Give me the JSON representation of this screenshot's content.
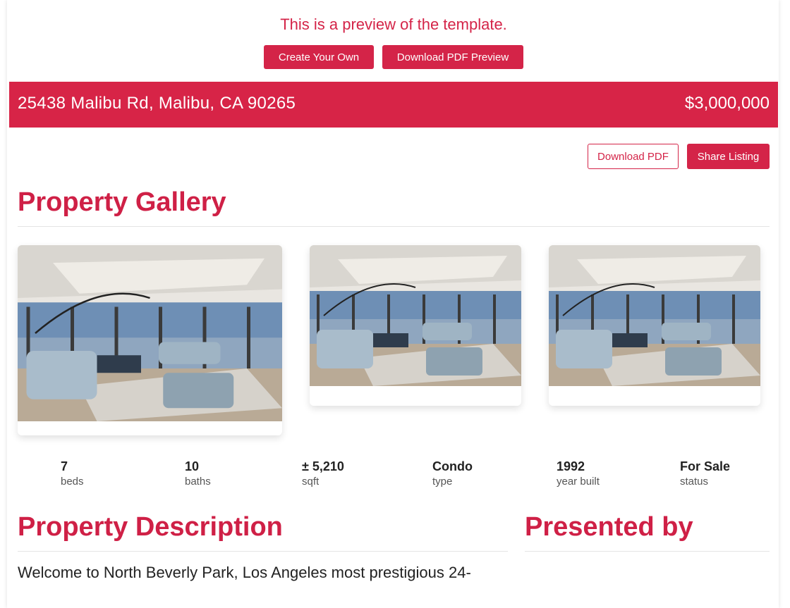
{
  "preview": {
    "message": "This is a preview of the template.",
    "create_label": "Create Your Own",
    "download_preview_label": "Download PDF Preview"
  },
  "banner": {
    "address": "25438 Malibu Rd, Malibu, CA 90265",
    "price": "$3,000,000"
  },
  "actions": {
    "download_pdf_label": "Download PDF",
    "share_label": "Share Listing"
  },
  "gallery": {
    "title": "Property Gallery",
    "photos": [
      "living-room-photo",
      "living-room-photo",
      "living-room-photo"
    ]
  },
  "stats": [
    {
      "value": "7",
      "label": "beds"
    },
    {
      "value": "10",
      "label": "baths"
    },
    {
      "value": "± 5,210",
      "label": "sqft"
    },
    {
      "value": "Condo",
      "label": "type"
    },
    {
      "value": "1992",
      "label": "year built"
    },
    {
      "value": "For Sale",
      "label": "status"
    }
  ],
  "description": {
    "title": "Property Description",
    "text": "Welcome to North Beverly Park, Los Angeles most prestigious 24-"
  },
  "presented_by": {
    "title": "Presented by"
  },
  "colors": {
    "brand": "#d72447"
  }
}
